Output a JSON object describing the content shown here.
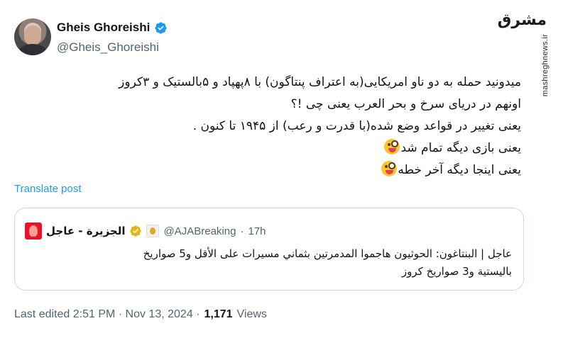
{
  "author": {
    "display_name": "Gheis Ghoreishi",
    "handle": "@Gheis_Ghoreishi",
    "verified_color": "#1d9bf0"
  },
  "watermark": {
    "logo_text": "مشرق",
    "url": "mashreghnews.ir"
  },
  "tweet": {
    "lines": [
      "میدونید حمله به دو ناو امریکایی(به اعتراف پنتاگون) با ۸پهپاد و ۵بالستیک و ۳کروز",
      "اونهم در دریای سرخ و بحر العرب یعنی چی !؟",
      "یعنی تغییر در قواعد وضع شده(با قدرت و رعب) از ۱۹۴۵ تا کنون .",
      "یعنی بازی دیگه تمام شد",
      "یعنی اینجا دیگه آخر خطه"
    ],
    "emoji_name": "winking-face-with-tongue"
  },
  "translate_label": "Translate post",
  "quote": {
    "name": "الجزيرة - عاجل",
    "handle": "@AJABreaking",
    "separator": "·",
    "time": "17h",
    "badge_color": "#e2a431",
    "lines": [
      "عاجل | البنتاغون: الحوثيون هاجموا المدمرتين بثماني مسيرات على الأقل و5 صواريخ",
      "باليستية و3 صواريخ كروز"
    ]
  },
  "meta": {
    "edited": "Last edited 2:51 PM · Nov 13, 2024 ·",
    "views_count": "1,171",
    "views_label": "Views"
  }
}
